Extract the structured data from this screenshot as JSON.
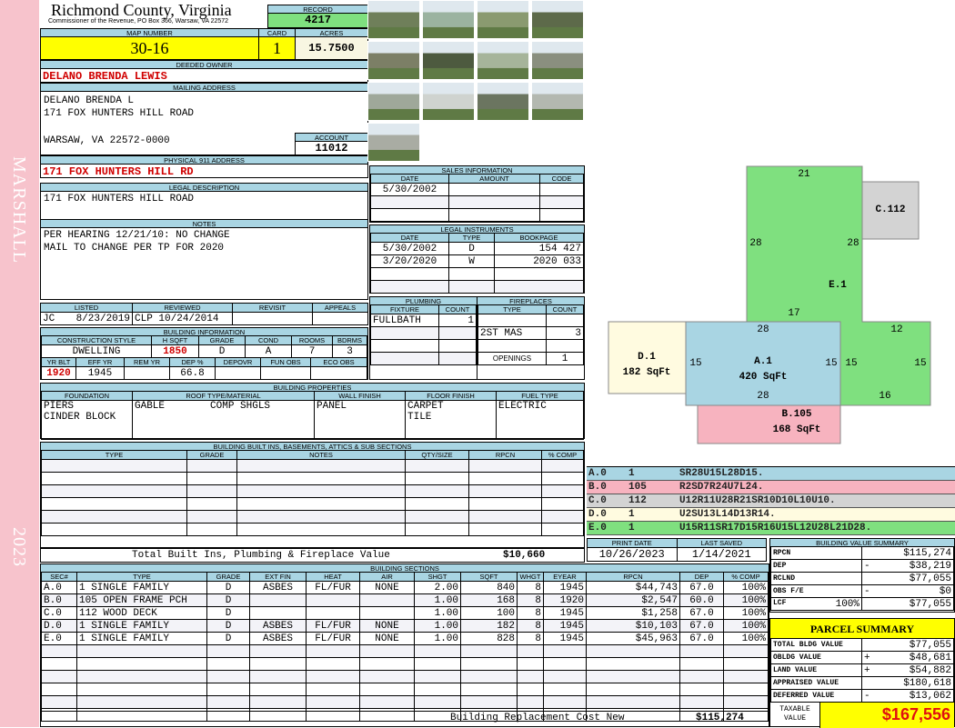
{
  "side": {
    "label": "MARSHALL",
    "year": "2023"
  },
  "header": {
    "title": "Richmond County, Virginia",
    "subtitle": "Commissioner of the Revenue, PO Box 366, Warsaw, VA 22572",
    "record_label": "RECORD",
    "record": "4217"
  },
  "parcel": {
    "map_label": "MAP NUMBER",
    "map": "30-16",
    "card_label": "CARD",
    "card": "1",
    "acres_label": "ACRES",
    "acres": "15.7500"
  },
  "owner": {
    "label": "DEEDED OWNER",
    "value": "DELANO BRENDA LEWIS"
  },
  "mailing": {
    "label": "MAILING ADDRESS",
    "line1": "DELANO BRENDA L",
    "line2": "171 FOX HUNTERS HILL ROAD",
    "line3": "WARSAW, VA 22572-0000",
    "account_label": "ACCOUNT",
    "account": "11012"
  },
  "physical": {
    "label": "PHYSICAL 911 ADDRESS",
    "value": "171 FOX HUNTERS HILL RD"
  },
  "legal": {
    "label": "LEGAL DESCRIPTION",
    "value": "171 FOX HUNTERS HILL ROAD"
  },
  "notes": {
    "label": "NOTES",
    "line1": "PER HEARING 12/21/10: NO CHANGE",
    "line2": "MAIL TO CHANGE PER TP FOR 2020"
  },
  "listing": {
    "listed_label": "LISTED",
    "listed_by": "JC",
    "listed": "8/23/2019",
    "reviewed_label": "REVIEWED",
    "reviewed_by": "CLP",
    "reviewed": "10/24/2014",
    "revisit_label": "REVISIT",
    "appeals_label": "APPEALS"
  },
  "building": {
    "label": "BUILDING INFORMATION",
    "h": [
      "CONSTRUCTION STYLE",
      "H SQFT",
      "GRADE",
      "COND",
      "ROOMS",
      "BDRMS"
    ],
    "v": [
      "DWELLING",
      "1850",
      "D",
      "A",
      "7",
      "3"
    ],
    "h2": [
      "YR BLT",
      "EFF YR",
      "REM YR",
      "DEP %",
      "DEPOVR",
      "FUN OBS",
      "ECO OBS"
    ],
    "v2": [
      "1920",
      "1945",
      "",
      "66.8",
      "",
      "",
      ""
    ]
  },
  "props": {
    "label": "BUILDING PROPERTIES",
    "h": [
      "FOUNDATION",
      "ROOF TYPE/MATERIAL",
      "WALL FINISH",
      "FLOOR FINISH",
      "FUEL TYPE"
    ],
    "foundation": [
      "PIERS",
      "CINDER BLOCK"
    ],
    "roof_type": "GABLE",
    "roof_material": "COMP SHGLS",
    "wall": "PANEL",
    "floor": [
      "CARPET",
      "TILE"
    ],
    "fuel": "ELECTRIC"
  },
  "builtins": {
    "label": "BUILDING BUILT INS, BASEMENTS, ATTICS & SUB SECTIONS",
    "h": [
      "TYPE",
      "GRADE",
      "NOTES",
      "QTY/SIZE",
      "RPCN",
      "% COMP"
    ],
    "total_label": "Total Built Ins, Plumbing & Fireplace Value",
    "total": "$10,660"
  },
  "sales": {
    "label": "SALES INFORMATION",
    "h": [
      "DATE",
      "AMOUNT",
      "CODE"
    ],
    "rows": [
      [
        "5/30/2002",
        "",
        ""
      ]
    ]
  },
  "instruments": {
    "label": "LEGAL INSTRUMENTS",
    "h": [
      "DATE",
      "TYPE",
      "BOOKPAGE"
    ],
    "rows": [
      [
        "5/30/2002",
        "D",
        "154 427"
      ],
      [
        "3/20/2020",
        "W",
        "2020 033"
      ]
    ]
  },
  "plumbing": {
    "label": "PLUMBING",
    "h": [
      "FIXTURE",
      "COUNT"
    ],
    "rows": [
      [
        "FULLBATH",
        "1"
      ]
    ]
  },
  "fireplaces": {
    "label": "FIREPLACES",
    "h": [
      "TYPE",
      "COUNT"
    ],
    "rows": [
      [
        "2ST MAS",
        "3"
      ]
    ],
    "openings_label": "OPENINGS",
    "openings": "1"
  },
  "sketch": {
    "areas": [
      {
        "name": "E.1",
        "color": "#7fe07f"
      },
      {
        "name": "C.112",
        "color": "#d3d3d3"
      },
      {
        "name": "D.1",
        "area": "182 SqFt",
        "color": "#fffbe0"
      },
      {
        "name": "A.1",
        "area": "420 SqFt",
        "color": "#a9d5e3"
      },
      {
        "name": "B.105",
        "area": "168 SqFt",
        "color": "#f7b3bf"
      }
    ],
    "dims": [
      "21",
      "28",
      "28",
      "17",
      "28",
      "12",
      "15",
      "15",
      "15",
      "15",
      "28",
      "16"
    ],
    "codes": [
      {
        "sec": "A.0",
        "code": "1",
        "path": "SR28U15L28D15.",
        "color": "#a9d5e3"
      },
      {
        "sec": "B.0",
        "code": "105",
        "path": "R2SD7R24U7L24.",
        "color": "#f7b3bf"
      },
      {
        "sec": "C.0",
        "code": "112",
        "path": "U12R11U28R21SR10D10L10U10.",
        "color": "#d3d3d3"
      },
      {
        "sec": "D.0",
        "code": "1",
        "path": "U2SU13L14D13R14.",
        "color": "#fffbe0"
      },
      {
        "sec": "E.0",
        "code": "1",
        "path": "U15R11SR17D15R16U15L12U28L21D28.",
        "color": "#7fe07f"
      }
    ]
  },
  "dates": {
    "print_label": "PRINT DATE",
    "print": "10/26/2023",
    "saved_label": "LAST SAVED",
    "saved": "1/14/2021"
  },
  "sections": {
    "label": "BUILDING SECTIONS",
    "h": [
      "SEC#",
      "TYPE",
      "GRADE",
      "EXT FIN",
      "HEAT",
      "AIR",
      "SHGT",
      "SQFT",
      "WHGT",
      "EYEAR",
      "RPCN",
      "DEP",
      "% COMP"
    ],
    "rows": [
      [
        "A.0",
        "1 SINGLE FAMILY",
        "D",
        "ASBES",
        "FL/FUR",
        "NONE",
        "2.00",
        "840",
        "8",
        "1945",
        "$44,743",
        "67.0",
        "100%"
      ],
      [
        "B.0",
        "105 OPEN FRAME PCH",
        "D",
        "",
        "",
        "",
        "1.00",
        "168",
        "8",
        "1920",
        "$2,547",
        "60.0",
        "100%"
      ],
      [
        "C.0",
        "112 WOOD DECK",
        "D",
        "",
        "",
        "",
        "1.00",
        "100",
        "8",
        "1945",
        "$1,258",
        "67.0",
        "100%"
      ],
      [
        "D.0",
        "1 SINGLE FAMILY",
        "D",
        "ASBES",
        "FL/FUR",
        "NONE",
        "1.00",
        "182",
        "8",
        "1945",
        "$10,103",
        "67.0",
        "100%"
      ],
      [
        "E.0",
        "1 SINGLE FAMILY",
        "D",
        "ASBES",
        "FL/FUR",
        "NONE",
        "1.00",
        "828",
        "8",
        "1945",
        "$45,963",
        "67.0",
        "100%"
      ]
    ],
    "total_label": "Building Replacement Cost New",
    "total": "$115,274"
  },
  "bvs": {
    "label": "BUILDING VALUE SUMMARY",
    "rows": [
      {
        "k": "RPCN",
        "s": "",
        "v": "$115,274"
      },
      {
        "k": "DEP",
        "s": "-",
        "v": "$38,219"
      },
      {
        "k": "RCLND",
        "s": "",
        "v": "$77,055"
      },
      {
        "k": "OBS F/E",
        "s": "-",
        "v": "$0"
      },
      {
        "k": "LCF",
        "pct": "100%",
        "s": "",
        "v": "$77,055"
      }
    ]
  },
  "summary": {
    "label": "PARCEL SUMMARY",
    "rows": [
      {
        "k": "TOTAL BLDG VALUE",
        "s": "",
        "v": "$77,055"
      },
      {
        "k": "OBLDG VALUE",
        "s": "+",
        "v": "$48,681"
      },
      {
        "k": "LAND VALUE",
        "s": "+",
        "v": "$54,882"
      },
      {
        "k": "APPRAISED VALUE",
        "s": "",
        "v": "$180,618"
      },
      {
        "k": "DEFERRED VALUE",
        "s": "-",
        "v": "$13,062"
      }
    ],
    "taxable_label1": "TAXABLE",
    "taxable_label2": "VALUE",
    "taxable": "$167,556"
  }
}
